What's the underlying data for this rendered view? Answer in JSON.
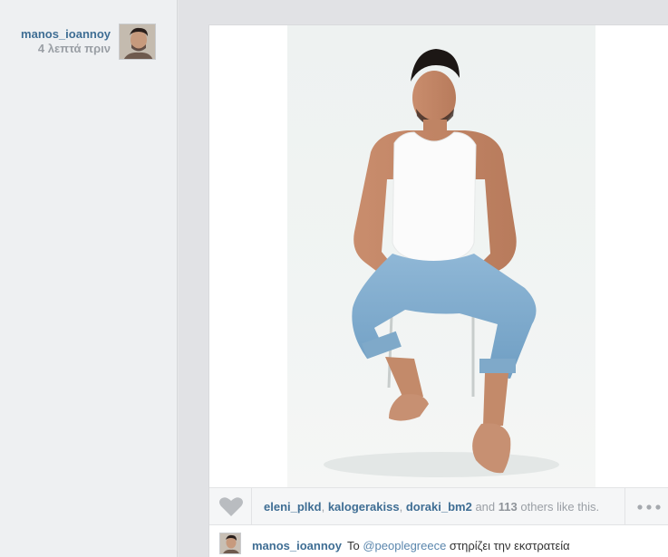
{
  "post": {
    "username": "manos_ioannoy",
    "time_ago": "4 λεπτά πριν"
  },
  "likes": {
    "users": [
      "eleni_plkd",
      "kalogerakiss",
      "doraki_bm2"
    ],
    "sep": ", ",
    "and_text": "and",
    "count": "113",
    "suffix": "others like this."
  },
  "caption": {
    "username": "manos_ioannoy",
    "prefix": "Το ",
    "mention": "@peoplegreece",
    "rest": " στηρίζει την εκστρατεία"
  },
  "icons": {
    "like": "heart-icon",
    "more": "more-dots-icon",
    "avatar": "avatar"
  },
  "colors": {
    "link": "#3f6e94",
    "muted": "#9a9fa5",
    "page_bg": "#e6e7e9"
  }
}
